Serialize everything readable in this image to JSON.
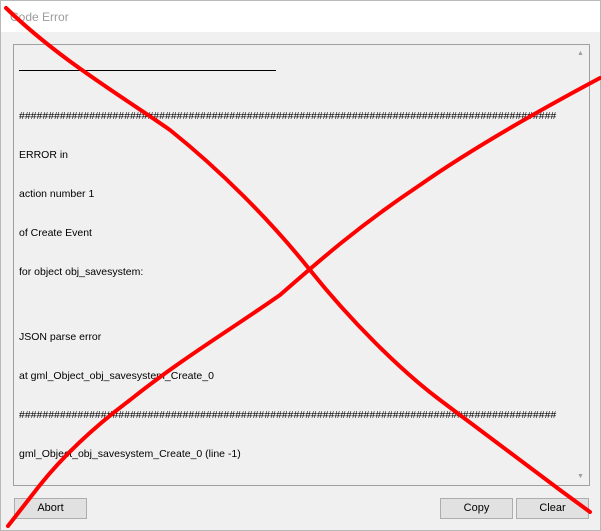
{
  "window": {
    "title": "Code Error"
  },
  "error_text": {
    "lines": [
      "",
      "############################################################################################",
      "ERROR in",
      "action number 1",
      "of Create Event",
      "for object obj_savesystem:",
      "",
      "JSON parse error",
      "at gml_Object_obj_savesystem_Create_0",
      "############################################################################################",
      "gml_Object_obj_savesystem_Create_0 (line -1)"
    ]
  },
  "scrollbar": {
    "up_icon": "triangle-up",
    "down_icon": "triangle-down"
  },
  "buttons": {
    "abort": "Abort",
    "copy": "Copy",
    "clear": "Clear"
  },
  "overlay": {
    "color": "#ff0000"
  }
}
